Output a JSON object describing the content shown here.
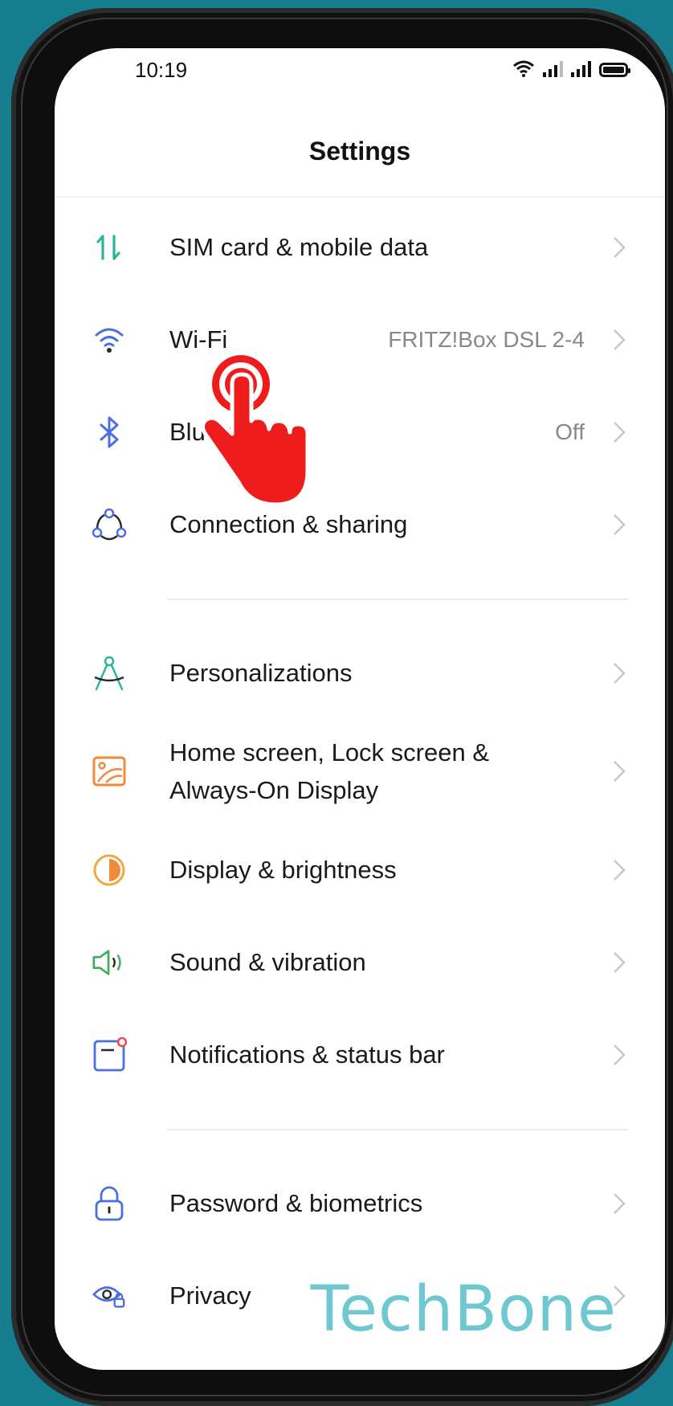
{
  "status_bar": {
    "time": "10:19"
  },
  "header": {
    "title": "Settings"
  },
  "items": {
    "sim": {
      "label": "SIM card & mobile data"
    },
    "wifi": {
      "label": "Wi-Fi",
      "value": "FRITZ!Box DSL 2-4"
    },
    "bluetooth": {
      "label": "Bluetooth",
      "value": "Off"
    },
    "connection": {
      "label": "Connection & sharing"
    },
    "personalizations": {
      "label": "Personalizations"
    },
    "home": {
      "label_line1": "Home screen, Lock screen &",
      "label_line2": "Always-On Display"
    },
    "display": {
      "label": "Display & brightness"
    },
    "sound": {
      "label": "Sound & vibration"
    },
    "notifications": {
      "label": "Notifications & status bar"
    },
    "password": {
      "label": "Password & biometrics"
    },
    "privacy": {
      "label": "Privacy"
    }
  },
  "watermark": "TechBone",
  "colors": {
    "background": "#157d8d",
    "accent_green": "#2bb59a",
    "accent_blue": "#4a6fe0",
    "tap_red": "#ee1c1c",
    "watermark": "#6ec8d2"
  }
}
